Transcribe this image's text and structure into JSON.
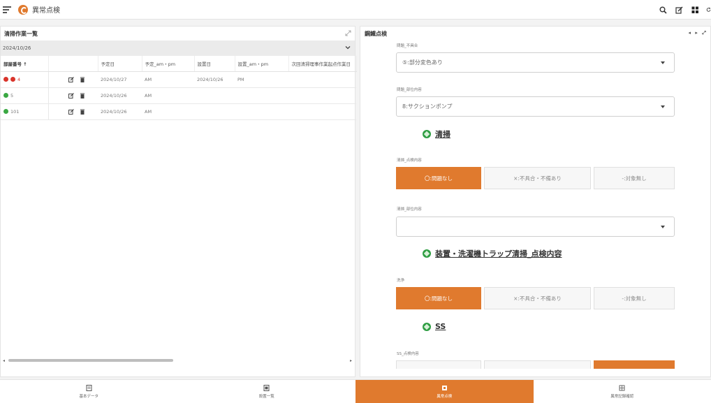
{
  "app": {
    "title": "異常点検"
  },
  "left_panel": {
    "title": "清掃作業一覧",
    "date_selected": "2024/10/26",
    "columns": [
      "部屋番号 ↑",
      "",
      "予定日",
      "予定_am・pm",
      "設置日",
      "設置_am・pm",
      "次回清掃理事作業起点作業日"
    ],
    "rows": [
      {
        "status": "red-red",
        "number": "4",
        "planned": "2024/10/27",
        "planned_ampm": "AM",
        "set_date": "2024/10/26",
        "set_ampm": "PM"
      },
      {
        "status": "green",
        "number": "5",
        "planned": "2024/10/26",
        "planned_ampm": "AM",
        "set_date": "",
        "set_ampm": ""
      },
      {
        "status": "green",
        "number": "101",
        "planned": "2024/10/26",
        "planned_ampm": "AM",
        "set_date": "",
        "set_ampm": ""
      }
    ]
  },
  "right_panel": {
    "title": "鋼鐵点検",
    "field1": {
      "label": "問題_不具合",
      "value": "⑤:部分変色あり"
    },
    "field2": {
      "label": "問題_部位内容",
      "value": "8:サクションポンプ"
    },
    "link1": "清掃",
    "field3_label": "清掃_点検内容",
    "seg_options": [
      "〇:問題なし",
      "×:不具合・不備あり",
      "-:対象無し"
    ],
    "field4_label": "清掃_部位内容",
    "field4_value": "",
    "link2": "装置・洗濯機トラップ清掃_点検内容",
    "field5_label": "洗浄",
    "link3": "SS",
    "field6_label": "SS_点検内容"
  },
  "tabs": [
    {
      "label": "基本データ",
      "icon": "document-icon"
    },
    {
      "label": "設置一覧",
      "icon": "list-icon"
    },
    {
      "label": "異常点検",
      "icon": "inspect-icon"
    },
    {
      "label": "異常記録確認",
      "icon": "grid-icon"
    }
  ],
  "colors": {
    "accent": "#e07a2e",
    "ok": "#3aa843",
    "ng": "#d9342b"
  }
}
